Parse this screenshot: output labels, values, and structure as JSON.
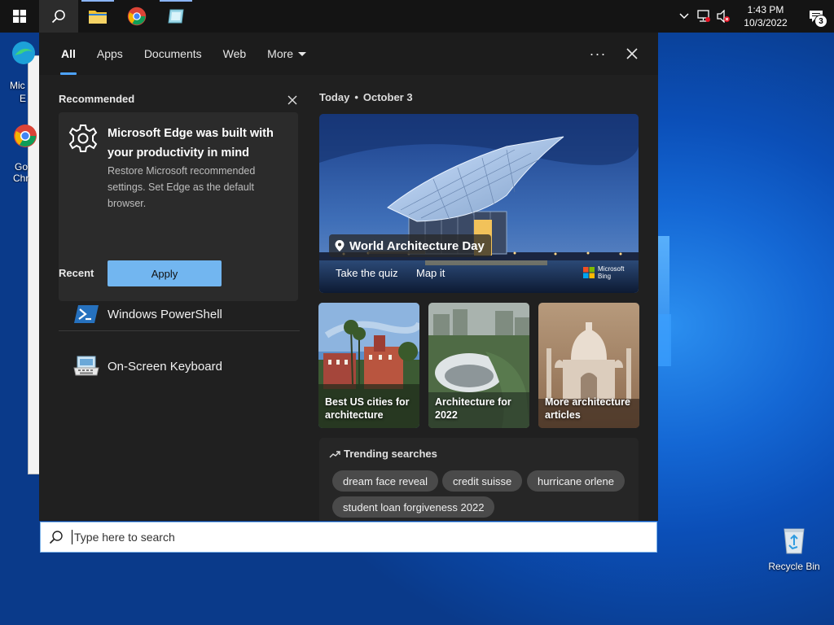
{
  "taskbar": {
    "time": "1:43 PM",
    "date": "10/3/2022",
    "notification_count": "3"
  },
  "desktop": {
    "left_icon_1_text_a": "Mic",
    "left_icon_1_text_b": "E",
    "left_icon_2_text_a": "Go",
    "left_icon_2_text_b": "Chr",
    "recycle_bin": "Recycle Bin"
  },
  "search": {
    "tabs": [
      {
        "label": "All"
      },
      {
        "label": "Apps"
      },
      {
        "label": "Documents"
      },
      {
        "label": "Web"
      },
      {
        "label": "More"
      }
    ],
    "more_options": "···",
    "placeholder": "Type here to search"
  },
  "recommended": {
    "heading": "Recommended",
    "title": "Microsoft Edge was built with your productivity in mind",
    "description": "Restore Microsoft recommended settings. Set Edge as the default browser.",
    "apply_label": "Apply"
  },
  "recent": {
    "heading": "Recent",
    "items": [
      {
        "label": "Windows PowerShell"
      },
      {
        "label": "On-Screen Keyboard"
      }
    ]
  },
  "today": {
    "label": "Today",
    "date": "October 3",
    "hero_title": "World Architecture Day",
    "hero_link_1": "Take the quiz",
    "hero_link_2": "Map it",
    "bing_line_1": "Microsoft",
    "bing_line_2": "Bing",
    "tiles": [
      {
        "label": "Best US cities for architecture"
      },
      {
        "label": "Architecture for 2022"
      },
      {
        "label": "More architecture articles"
      }
    ]
  },
  "trending": {
    "heading": "Trending searches",
    "chips": [
      {
        "label": "dream face reveal"
      },
      {
        "label": "credit suisse"
      },
      {
        "label": "hurricane orlene"
      },
      {
        "label": "student loan forgiveness 2022"
      }
    ]
  },
  "colors": {
    "accent": "#4da3ff",
    "apply_button": "#72b6f0",
    "flyout_bg": "#202020",
    "taskbar_bg": "#141414"
  }
}
